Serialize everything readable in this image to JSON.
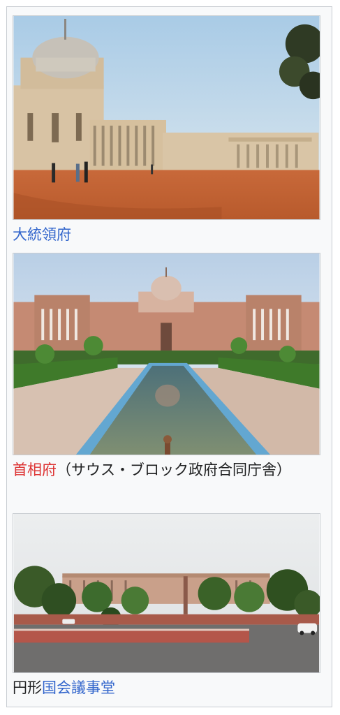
{
  "colors": {
    "link": "#3366cc",
    "new_link": "#dd3333",
    "text": "#202122",
    "frame_bg": "#f8f9fa",
    "border": "#c8ccd1"
  },
  "gallery": {
    "items": [
      {
        "image": "rashtrapati-bhavan-photo",
        "caption_link": "大統領府"
      },
      {
        "image": "north-south-block-photo",
        "caption_link": "首相府",
        "caption_text": "（サウス・ブロック政府合同庁舎）"
      },
      {
        "image": "parliament-house-photo",
        "caption_prefix": "円形",
        "caption_link": "国会議事堂"
      }
    ]
  }
}
